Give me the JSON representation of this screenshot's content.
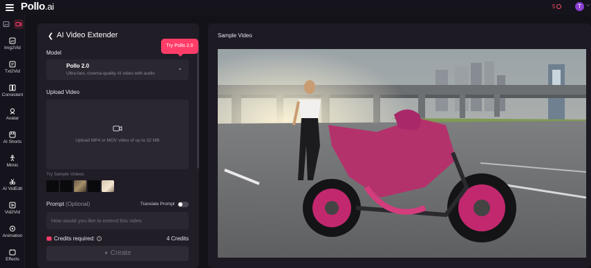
{
  "topbar": {
    "logo_main": "Pollo",
    "logo_suffix": ".ai",
    "credits": "5",
    "avatar_initial": "T"
  },
  "nav": {
    "items": [
      {
        "label": "Img2Vid",
        "icon": "image-to-video-icon"
      },
      {
        "label": "Txt2Vid",
        "icon": "text-to-video-icon"
      },
      {
        "label": "Consistent",
        "icon": "consistent-icon"
      },
      {
        "label": "Avatar",
        "icon": "avatar-icon"
      },
      {
        "label": "AI Shorts",
        "icon": "shorts-icon"
      },
      {
        "label": "Mimic",
        "icon": "mimic-icon"
      },
      {
        "label": "AI VidEdit",
        "icon": "video-edit-icon"
      },
      {
        "label": "Vid2Vid",
        "icon": "video-to-video-icon"
      },
      {
        "label": "Animation",
        "icon": "animation-icon"
      },
      {
        "label": "Effects",
        "icon": "effects-icon"
      }
    ]
  },
  "panel": {
    "title": "AI Video Extender",
    "try_badge": "Try Pollo 2.0",
    "model_label": "Model",
    "model": {
      "name": "Pollo 2.0",
      "description": "Ultra-fast, cinema-quality AI video with audio"
    },
    "upload_label": "Upload Video",
    "upload_hint": "Upload MP4 or MOV video of up to 32 MB",
    "sample_label": "Try Sample Videos",
    "prompt_label": "Prompt",
    "prompt_optional": "(Optional)",
    "translate_label": "Translate Prompt",
    "prompt_placeholder": "How would you like to extend this video",
    "credits_label": "Credits required:",
    "credits_value": "4 Credits",
    "create_label": "Create"
  },
  "preview": {
    "title": "Sample Video"
  },
  "colors": {
    "accent": "#ff3d68",
    "background": "#141219",
    "panel": "#201d27"
  }
}
